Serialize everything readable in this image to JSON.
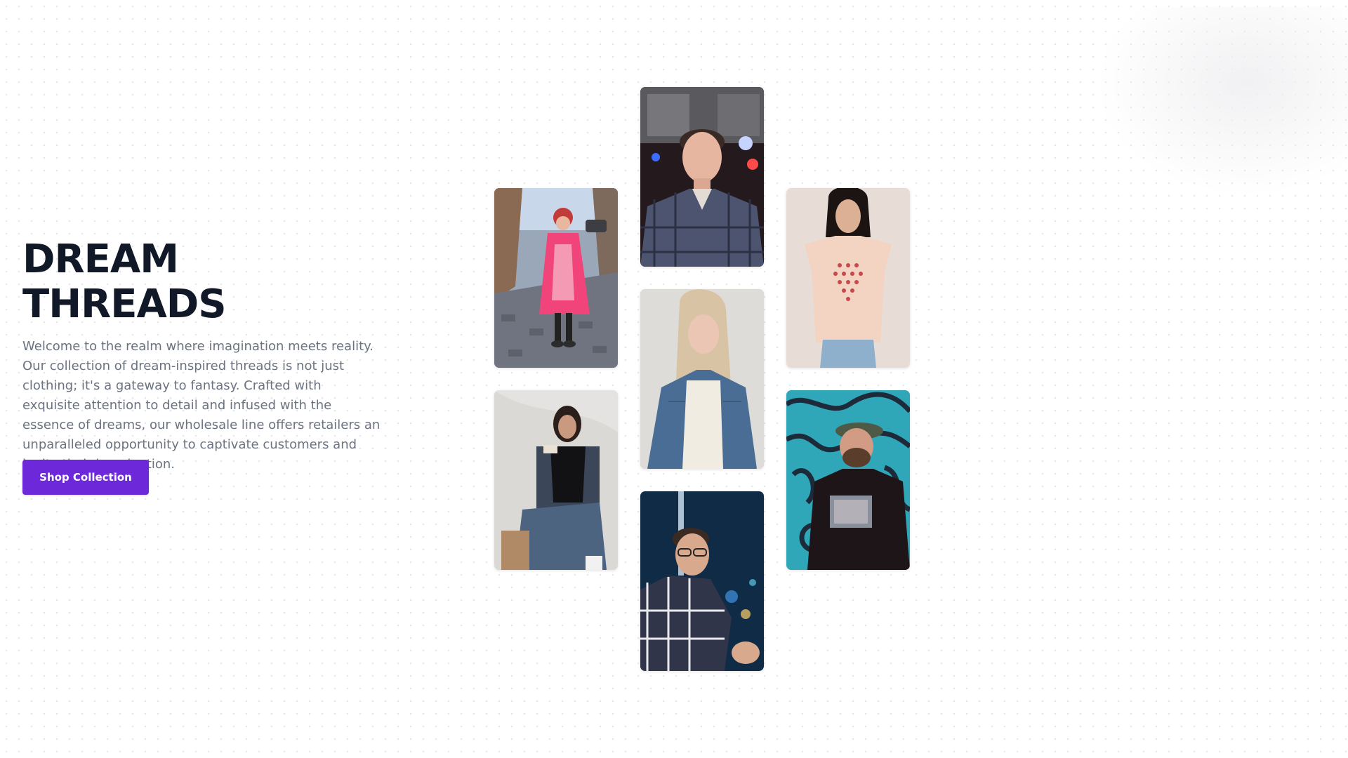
{
  "hero": {
    "title": "DREAM THREADS",
    "description": "Welcome to the realm where imagination meets reality. Our collection of dream-inspired threads is not just clothing; it's a gateway to fantasy. Crafted with exquisite attention to detail and infused with the essence of dreams, our wholesale line offers retailers an unparalleled opportunity to captivate customers and ignite their imagination.",
    "cta_label": "Shop Collection"
  },
  "colors": {
    "accent": "#6d28d9",
    "heading": "#111827",
    "body_text": "#6b7280",
    "background": "#ffffff"
  },
  "gallery": [
    "woman in pink raincoat on cobblestone street",
    "man in plaid shirt in neon arcade",
    "woman in denim jacket and white top",
    "man with glasses in plaid shirt at night city",
    "woman in black top and denim jacket seated",
    "woman in peach t-shirt with heart print",
    "man in black hoodie and cap by graffiti wall"
  ]
}
